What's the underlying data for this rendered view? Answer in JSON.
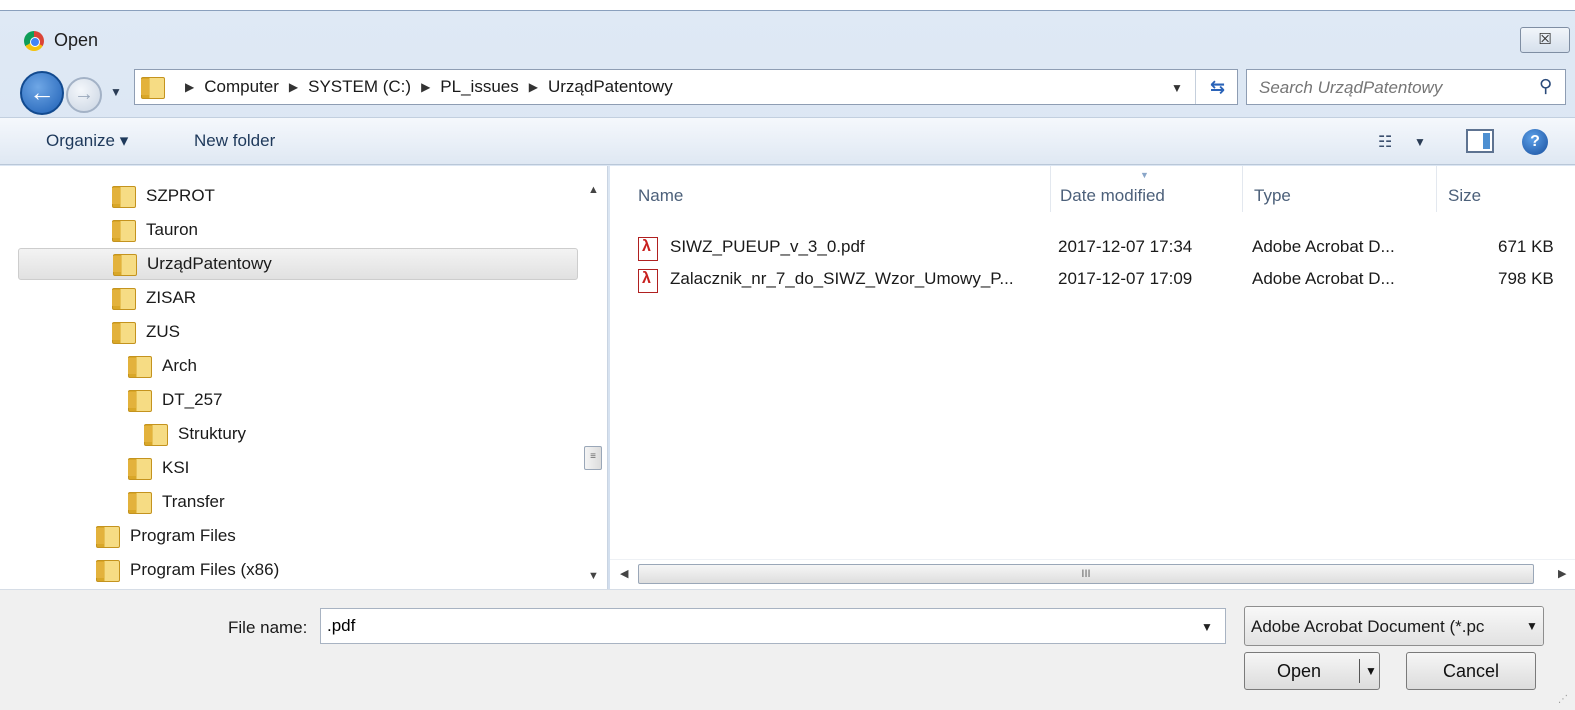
{
  "window": {
    "title": "Open",
    "close_symbol": "☒"
  },
  "nav": {
    "back_symbol": "←",
    "forward_symbol": "→",
    "history_dropdown": "▼",
    "breadcrumb": [
      "Computer",
      "SYSTEM (C:)",
      "PL_issues",
      "UrządPatentowy"
    ],
    "refresh_symbol": "⇆"
  },
  "search": {
    "placeholder": "Search UrządPatentowy"
  },
  "toolbar": {
    "organize": "Organize ▾",
    "new_folder": "New folder"
  },
  "tree": [
    {
      "label": "SZPROT",
      "indent": 1,
      "selected": false
    },
    {
      "label": "Tauron",
      "indent": 1,
      "selected": false
    },
    {
      "label": "UrządPatentowy",
      "indent": 1,
      "selected": true
    },
    {
      "label": "ZISAR",
      "indent": 1,
      "selected": false
    },
    {
      "label": "ZUS",
      "indent": 1,
      "selected": false
    },
    {
      "label": "Arch",
      "indent": 2,
      "selected": false
    },
    {
      "label": "DT_257",
      "indent": 2,
      "selected": false
    },
    {
      "label": "Struktury",
      "indent": 3,
      "selected": false
    },
    {
      "label": "KSI",
      "indent": 2,
      "selected": false
    },
    {
      "label": "Transfer",
      "indent": 2,
      "selected": false
    },
    {
      "label": "Program Files",
      "indent": 0,
      "selected": false
    },
    {
      "label": "Program Files (x86)",
      "indent": 0,
      "selected": false
    }
  ],
  "columns": {
    "name": "Name",
    "date": "Date modified",
    "type": "Type",
    "size": "Size"
  },
  "files": [
    {
      "name": "SIWZ_PUEUP_v_3_0.pdf",
      "date": "2017-12-07 17:34",
      "type": "Adobe Acrobat D...",
      "size": "671 KB"
    },
    {
      "name": "Zalacznik_nr_7_do_SIWZ_Wzor_Umowy_P...",
      "date": "2017-12-07 17:09",
      "type": "Adobe Acrobat D...",
      "size": "798 KB"
    }
  ],
  "scroll": {
    "thumb_grip": "≡",
    "hthumb_grip": "III"
  },
  "bottom": {
    "file_name_label": "File name:",
    "file_name_value": ".pdf",
    "file_type": "Adobe Acrobat Document (*.pc",
    "open_label": "Open",
    "cancel_label": "Cancel"
  }
}
